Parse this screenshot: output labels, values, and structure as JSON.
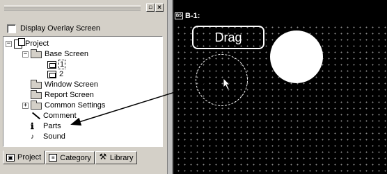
{
  "workspace": {
    "overlay_checkbox_label": "Display Overlay Screen",
    "overlay_checked": false,
    "tree": {
      "project": "Project",
      "base_screen": "Base Screen",
      "screen_1": "1",
      "screen_2": "2",
      "window_screen": "Window Screen",
      "report_screen": "Report Screen",
      "common_settings": "Common Settings",
      "comment": "Comment",
      "parts": "Parts",
      "sound": "Sound"
    },
    "tabs": [
      "Project",
      "Category",
      "Library"
    ]
  },
  "editor": {
    "title": "B-1:",
    "drag_label": "Drag"
  },
  "colors": {
    "panel_bg": "#d4d0c8",
    "editor_bg": "#000000",
    "grid_dot": "#8c8c8c"
  }
}
